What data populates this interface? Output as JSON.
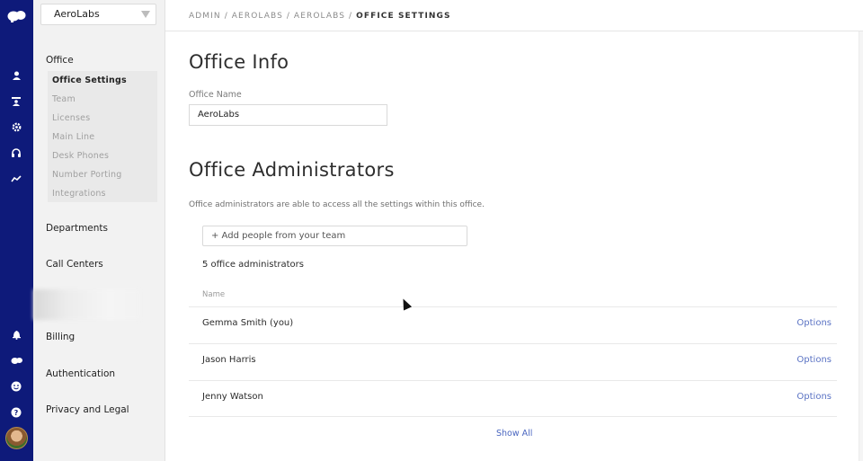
{
  "rail": {
    "icons": [
      "logo-icon",
      "user-icon",
      "contacts-icon",
      "gear-icon",
      "headset-icon",
      "analytics-icon",
      "bell-icon",
      "logo-small-icon",
      "smiley-icon",
      "help-icon"
    ]
  },
  "sidebar": {
    "office_select": "AeroLabs",
    "office_heading": "Office",
    "office_items": [
      {
        "label": "Office Settings",
        "active": true
      },
      {
        "label": "Team"
      },
      {
        "label": "Licenses"
      },
      {
        "label": "Main Line"
      },
      {
        "label": "Desk Phones"
      },
      {
        "label": "Number Porting"
      },
      {
        "label": "Integrations"
      }
    ],
    "sections": [
      "Departments",
      "Call Centers",
      "Billing",
      "Authentication",
      "Privacy and Legal"
    ]
  },
  "header": {
    "breadcrumb_path": "ADMIN / AEROLABS / AEROLABS / ",
    "breadcrumb_current": "OFFICE SETTINGS"
  },
  "office_info": {
    "title": "Office Info",
    "name_label": "Office Name",
    "name_value": "AeroLabs"
  },
  "admins": {
    "title": "Office Administrators",
    "description": "Office administrators are able to access all the settings within this office.",
    "add_placeholder": "+ Add people from your team",
    "count_text": "5 office administrators",
    "column_name": "Name",
    "rows": [
      {
        "name": "Gemma Smith (you)",
        "action": "Options"
      },
      {
        "name": "Jason Harris",
        "action": "Options"
      },
      {
        "name": "Jenny Watson",
        "action": "Options"
      }
    ],
    "show_all": "Show All"
  }
}
